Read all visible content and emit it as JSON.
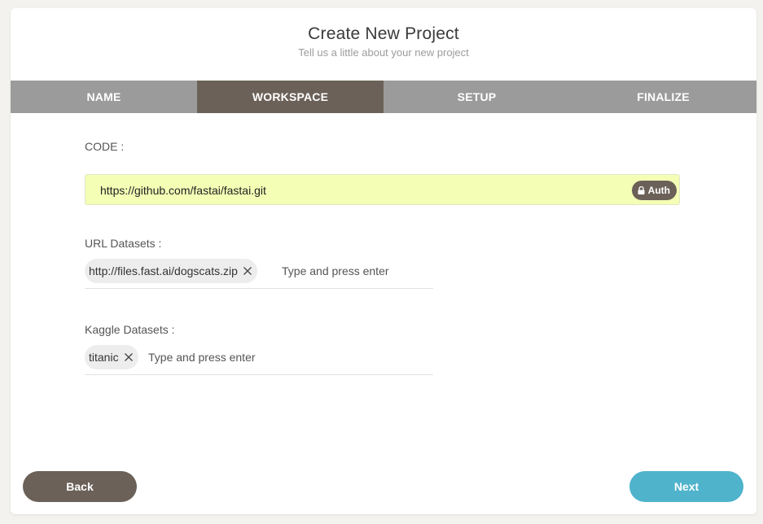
{
  "header": {
    "title": "Create New Project",
    "subtitle": "Tell us a little about your new project"
  },
  "steps": [
    {
      "label": "NAME",
      "active": false
    },
    {
      "label": "WORKSPACE",
      "active": true
    },
    {
      "label": "SETUP",
      "active": false
    },
    {
      "label": "FINALIZE",
      "active": false
    }
  ],
  "code": {
    "label": "CODE :",
    "value": "https://github.com/fastai/fastai.git",
    "auth_label": "Auth",
    "auth_icon": "lock-icon"
  },
  "url_datasets": {
    "label": "URL Datasets :",
    "tags": [
      "http://files.fast.ai/dogscats.zip"
    ],
    "placeholder": "Type and press enter"
  },
  "kaggle_datasets": {
    "label": "Kaggle Datasets :",
    "tags": [
      "titanic"
    ],
    "placeholder": "Type and press enter"
  },
  "footer": {
    "back_label": "Back",
    "next_label": "Next"
  },
  "colors": {
    "background": "#f3f2ef",
    "steps_bar": "#9b9b9b",
    "active_step": "#6b6158",
    "code_background": "#f4feb5",
    "next_button": "#4fb3cc",
    "back_button": "#6b6158"
  }
}
